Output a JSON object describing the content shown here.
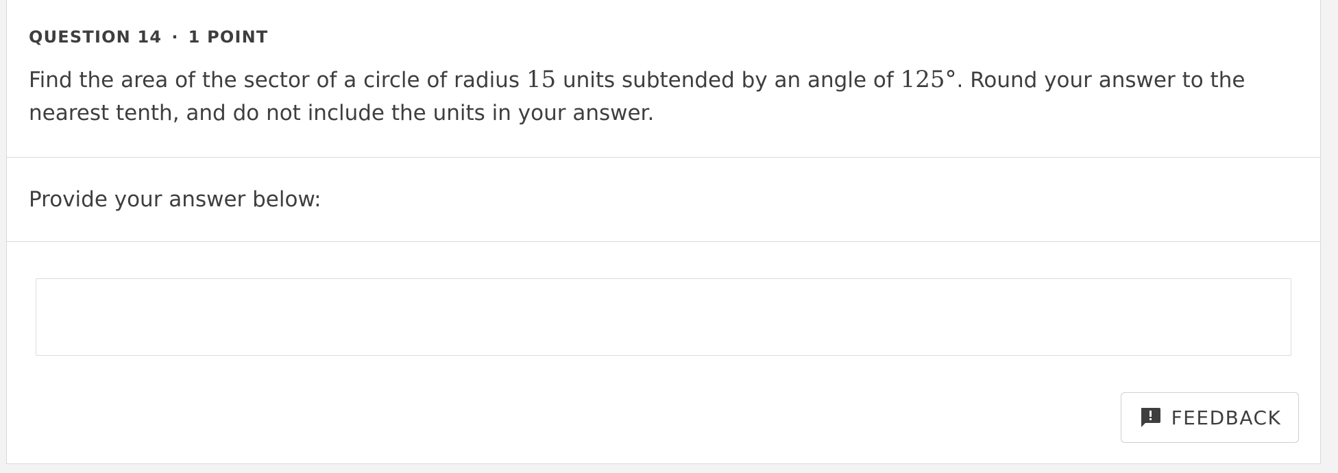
{
  "question": {
    "number_label": "QUESTION 14",
    "separator": "·",
    "points_label": "1 POINT",
    "text_part1": "Find the area of the sector of a circle of radius ",
    "radius": "15",
    "text_part2": " units subtended by an angle of ",
    "angle": "125°",
    "text_part3": ". Round your answer to the nearest tenth, and do not include the units in your answer."
  },
  "answer": {
    "prompt": "Provide your answer below:",
    "value": "",
    "placeholder": ""
  },
  "feedback": {
    "label": "FEEDBACK",
    "icon": "feedback-alert-icon"
  },
  "colors": {
    "text": "#3e3e3e",
    "border": "#d9d9d9",
    "background": "#f3f3f3",
    "card": "#ffffff"
  }
}
